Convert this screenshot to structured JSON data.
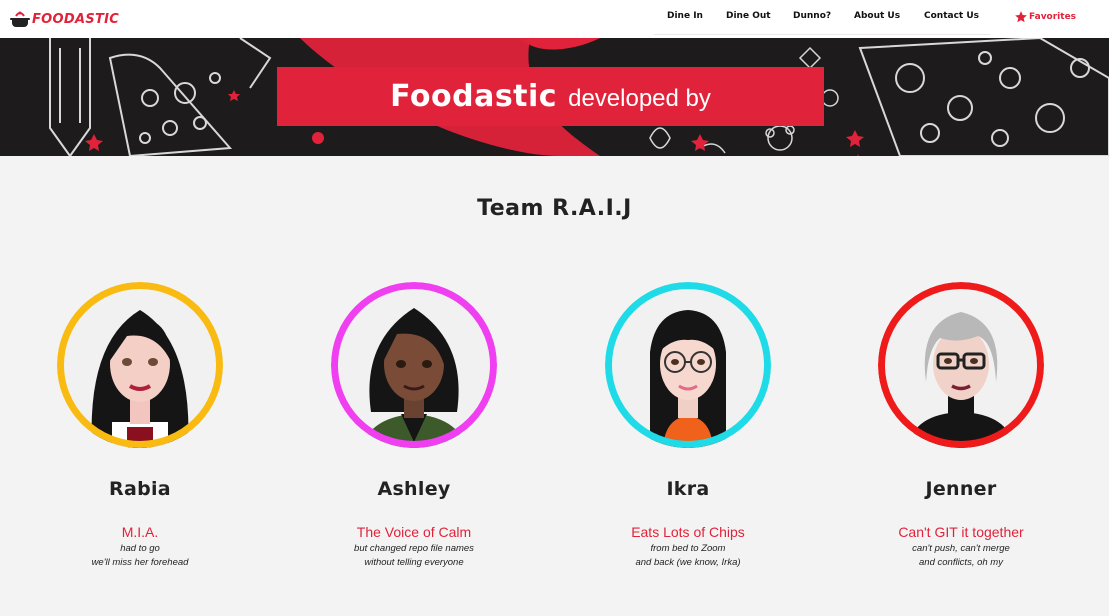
{
  "brand": {
    "name": "FOODASTIC"
  },
  "nav": {
    "links": [
      {
        "label": "Dine In"
      },
      {
        "label": "Dine Out"
      },
      {
        "label": "Dunno?"
      },
      {
        "label": "About Us"
      },
      {
        "label": "Contact Us"
      }
    ],
    "favorites": {
      "label": "Favorites",
      "icon": "star-icon"
    }
  },
  "hero": {
    "brand": "Foodastic",
    "subtitle": "developed by"
  },
  "team": {
    "title": "Team R.A.I.J",
    "members": [
      {
        "name": "Rabia",
        "role": "M.I.A.",
        "desc_line1": "had to go",
        "desc_line2": "we'll miss her forehead",
        "ring_color": "#f9bb12"
      },
      {
        "name": "Ashley",
        "role": "The Voice of Calm",
        "desc_line1": "but changed repo file names",
        "desc_line2": "without telling everyone",
        "ring_color": "#ef3ff0"
      },
      {
        "name": "Ikra",
        "role": "Eats Lots of Chips",
        "desc_line1": "from bed to Zoom",
        "desc_line2": "and back (we know, Irka)",
        "ring_color": "#1fdbe7"
      },
      {
        "name": "Jenner",
        "role": "Can't GIT it together",
        "desc_line1": "can't push, can't merge",
        "desc_line2": "and conflicts, oh my",
        "ring_color": "#ef1b1b"
      }
    ]
  },
  "colors": {
    "accent": "#e0233a",
    "hero_bg": "#1d1b1c",
    "page_bg": "#f3f3f3"
  }
}
